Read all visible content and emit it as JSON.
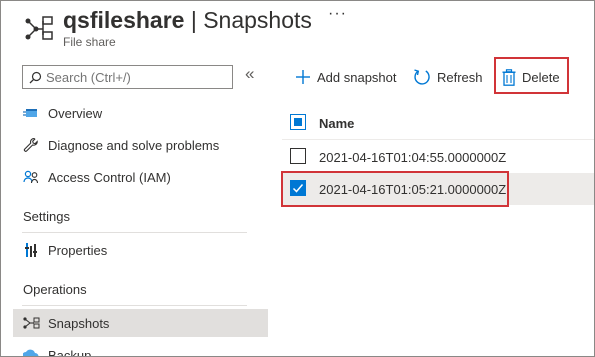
{
  "header": {
    "resource_name": "qsfileshare",
    "separator": "|",
    "page_name": "Snapshots",
    "more_label": "···",
    "resource_type": "File share",
    "icon": "file-share-icon"
  },
  "sidebar": {
    "search_placeholder": "Search (Ctrl+/)",
    "collapse_label": "«",
    "items": [
      {
        "label": "Overview",
        "icon": "overview-icon"
      },
      {
        "label": "Diagnose and solve problems",
        "icon": "wrench-icon"
      },
      {
        "label": "Access Control (IAM)",
        "icon": "people-icon"
      }
    ],
    "settings_label": "Settings",
    "settings_items": [
      {
        "label": "Properties",
        "icon": "properties-icon"
      }
    ],
    "operations_label": "Operations",
    "operations_items": [
      {
        "label": "Snapshots",
        "icon": "snapshot-icon",
        "active": true
      },
      {
        "label": "Backup",
        "icon": "backup-icon"
      }
    ]
  },
  "toolbar": {
    "add_snapshot": "Add snapshot",
    "refresh": "Refresh",
    "delete": "Delete"
  },
  "table": {
    "column_name": "Name",
    "rows": [
      {
        "name": "2021-04-16T01:04:55.0000000Z",
        "selected": false
      },
      {
        "name": "2021-04-16T01:05:21.0000000Z",
        "selected": true
      }
    ]
  },
  "colors": {
    "accent": "#0078d4",
    "highlight": "#d13438",
    "active_bg": "#e1dfdd"
  }
}
